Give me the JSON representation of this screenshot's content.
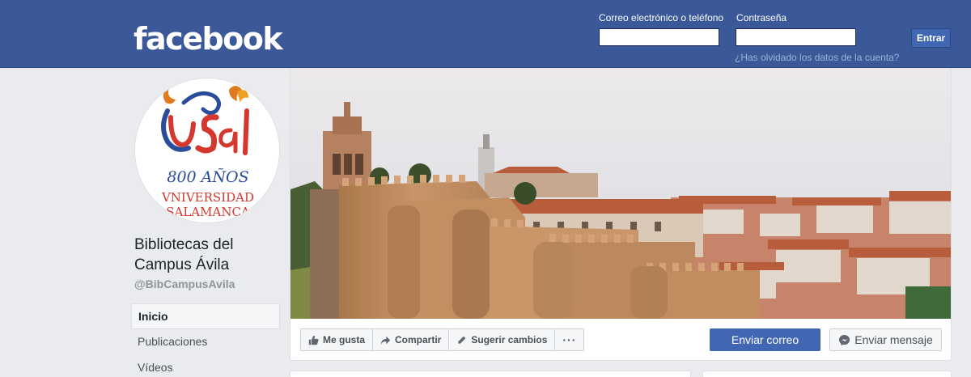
{
  "header": {
    "logo": "facebook",
    "email_label": "Correo electrónico o teléfono",
    "password_label": "Contraseña",
    "email_value": "",
    "password_value": "",
    "login_button": "Entrar",
    "forgot_link": "¿Has olvidado los datos de la cuenta?",
    "bg_color": "#3b5998"
  },
  "profile": {
    "name": "Bibliotecas del Campus Ávila",
    "handle": "@BibCampusAvila",
    "avatar": {
      "brand": "USal",
      "line1": "800 AÑOS",
      "line2": "VNIVERSIDAD",
      "line3": "SALAMANCA"
    }
  },
  "sidebar": {
    "items": [
      {
        "label": "Inicio",
        "active": true
      },
      {
        "label": "Publicaciones",
        "active": false
      },
      {
        "label": "Vídeos",
        "active": false
      }
    ]
  },
  "actions": {
    "like": "Me gusta",
    "share": "Compartir",
    "suggest": "Sugerir cambios",
    "more": "···",
    "send_email": "Enviar correo",
    "send_message": "Enviar mensaje"
  },
  "colors": {
    "brand_blue": "#4267b2",
    "page_bg": "#e9ebee"
  }
}
